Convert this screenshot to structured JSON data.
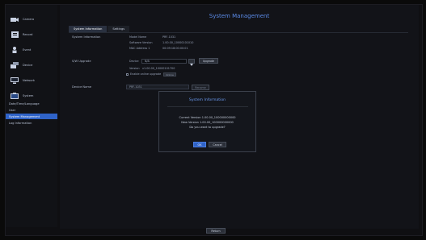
{
  "window": {
    "title": "System Management"
  },
  "sidebar": {
    "items": [
      {
        "label": "Camera",
        "icon": "camera-icon"
      },
      {
        "label": "Record",
        "icon": "record-icon"
      },
      {
        "label": "Event",
        "icon": "event-icon"
      },
      {
        "label": "Device",
        "icon": "device-icon"
      },
      {
        "label": "Network",
        "icon": "network-icon"
      },
      {
        "label": "System",
        "icon": "system-icon"
      }
    ],
    "sub_items": [
      {
        "label": "Date/Time/Language",
        "active": false
      },
      {
        "label": "User",
        "active": false
      },
      {
        "label": "System Management",
        "active": true
      },
      {
        "label": "Log Information",
        "active": false
      }
    ]
  },
  "main": {
    "tabs": [
      {
        "label": "System Information",
        "active": true
      },
      {
        "label": "Settings",
        "active": false
      }
    ],
    "system_information": {
      "label": "System Information",
      "fields": [
        {
          "label": "Model Name",
          "value": "PRF-1031"
        },
        {
          "label": "Software Version",
          "value": "1.00.00_10000101010"
        },
        {
          "label": "MAC Address 1",
          "value": "00:09:18:00:00:01"
        }
      ]
    },
    "sw_upgrade": {
      "label": "S/W Upgrade",
      "device_label": "Device",
      "device_value": "N/A",
      "upgrade_button": "Upgrade",
      "version_label": "Version",
      "version_value": "v1.00.00_10000101700",
      "checkbox_label": "Enable online upgrade",
      "ok_chip": "Online"
    },
    "device_name": {
      "label": "Device Name",
      "value": "PRF-1031",
      "button": "Rename"
    }
  },
  "modal": {
    "title": "System Information",
    "current_version": "Current Version 1.00.00_100000000000",
    "new_version": "New Version 1.00.00_100000000000",
    "question": "Do you want to upgrade?",
    "ok_label": "OK",
    "cancel_label": "Cancel"
  },
  "footer": {
    "return_label": "Return"
  },
  "colors": {
    "accent": "#2f63c8",
    "title": "#5b8be8",
    "background": "#0a0a0a"
  }
}
